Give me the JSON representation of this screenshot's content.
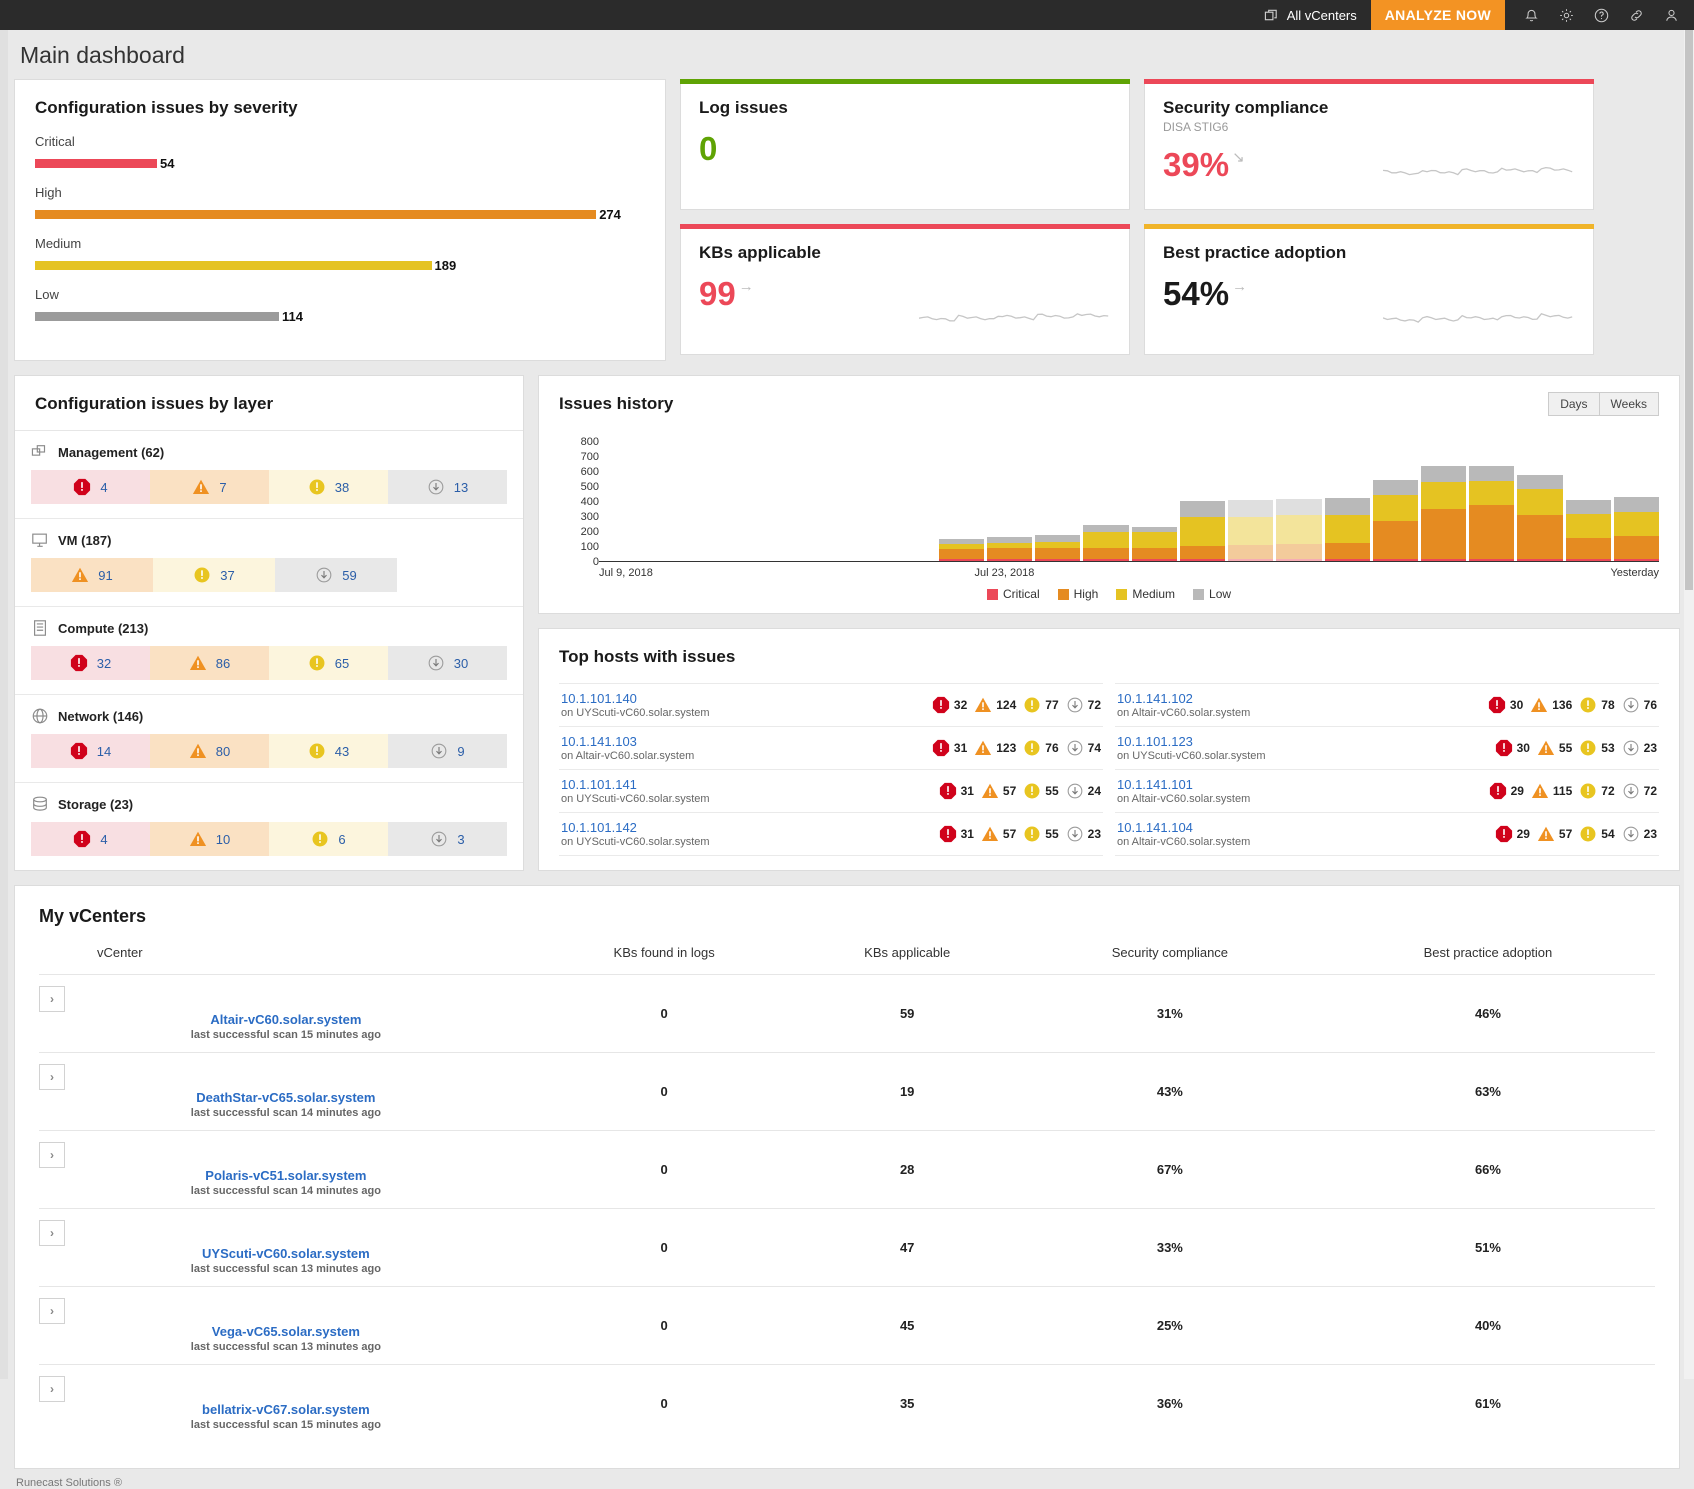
{
  "topbar": {
    "vcenters_label": "All vCenters",
    "analyze_label": "ANALYZE NOW",
    "icons": [
      "bell-icon",
      "gear-icon",
      "help-icon",
      "link-icon",
      "user-icon"
    ]
  },
  "page_title": "Main dashboard",
  "severity_card": {
    "title": "Configuration issues by severity",
    "items": [
      {
        "label": "Critical",
        "value": "54",
        "pct": 20,
        "color": "#ec4858"
      },
      {
        "label": "High",
        "value": "274",
        "pct": 92,
        "color": "#e58b21"
      },
      {
        "label": "Medium",
        "value": "189",
        "pct": 65,
        "color": "#e5c322"
      },
      {
        "label": "Low",
        "value": "114",
        "pct": 40,
        "color": "#9b9b9b"
      }
    ]
  },
  "kpis": [
    {
      "title": "Log issues",
      "subtitle": "",
      "value": "0",
      "accent": "#5fa304",
      "value_color": "#5fa304",
      "trend": "",
      "sparkline": false
    },
    {
      "title": "KBs applicable",
      "subtitle": "",
      "value": "99",
      "accent": "#ec4858",
      "value_color": "#ec4858",
      "trend": "→",
      "sparkline": true
    },
    {
      "title": "Security compliance",
      "subtitle": "DISA STIG6",
      "value": "39%",
      "accent": "#ec4858",
      "value_color": "#ec4858",
      "trend": "↘",
      "sparkline": true
    },
    {
      "title": "Best practice adoption",
      "subtitle": "",
      "value": "54%",
      "accent": "#f0b429",
      "value_color": "#1a1a1a",
      "trend": "→",
      "sparkline": true
    }
  ],
  "layer_card": {
    "title": "Configuration issues by layer",
    "layers": [
      {
        "icon": "management-icon",
        "label": "Management (62)",
        "chips": [
          {
            "sev": "critical",
            "value": "4"
          },
          {
            "sev": "high",
            "value": "7"
          },
          {
            "sev": "medium",
            "value": "38"
          },
          {
            "sev": "low",
            "value": "13"
          }
        ]
      },
      {
        "icon": "vm-icon",
        "label": "VM (187)",
        "chips": [
          {
            "sev": "high",
            "value": "91"
          },
          {
            "sev": "medium",
            "value": "37"
          },
          {
            "sev": "low",
            "value": "59"
          }
        ]
      },
      {
        "icon": "compute-icon",
        "label": "Compute (213)",
        "chips": [
          {
            "sev": "critical",
            "value": "32"
          },
          {
            "sev": "high",
            "value": "86"
          },
          {
            "sev": "medium",
            "value": "65"
          },
          {
            "sev": "low",
            "value": "30"
          }
        ]
      },
      {
        "icon": "network-icon",
        "label": "Network (146)",
        "chips": [
          {
            "sev": "critical",
            "value": "14"
          },
          {
            "sev": "high",
            "value": "80"
          },
          {
            "sev": "medium",
            "value": "43"
          },
          {
            "sev": "low",
            "value": "9"
          }
        ]
      },
      {
        "icon": "storage-icon",
        "label": "Storage (23)",
        "chips": [
          {
            "sev": "critical",
            "value": "4"
          },
          {
            "sev": "high",
            "value": "10"
          },
          {
            "sev": "medium",
            "value": "6"
          },
          {
            "sev": "low",
            "value": "3"
          }
        ]
      }
    ]
  },
  "history_card": {
    "title": "Issues history",
    "toggle": {
      "days": "Days",
      "weeks": "Weeks",
      "selected": "Days"
    }
  },
  "chart_data": {
    "type": "bar",
    "title": "Issues history",
    "stacked": true,
    "xlabel": "",
    "ylabel": "",
    "ylim": [
      0,
      800
    ],
    "yticks": [
      800,
      700,
      600,
      500,
      400,
      300,
      200,
      100,
      0
    ],
    "grid": false,
    "legend_position": "bottom",
    "x_tick_labels": [
      "Jul 9, 2018",
      "Jul 23, 2018",
      "Yesterday"
    ],
    "categories": [
      "d1",
      "d2",
      "d3",
      "d4",
      "d5",
      "d6",
      "d7",
      "d8",
      "d9",
      "d10",
      "d11",
      "d12",
      "d13",
      "d14",
      "d15",
      "d16",
      "d17",
      "d18",
      "d19",
      "d20",
      "d21",
      "d22"
    ],
    "series": [
      {
        "name": "Critical",
        "color": "#ec4858",
        "values": [
          0,
          0,
          0,
          0,
          0,
          0,
          0,
          12,
          12,
          12,
          14,
          14,
          14,
          14,
          16,
          16,
          16,
          16,
          16,
          16,
          16,
          16
        ]
      },
      {
        "name": "High",
        "color": "#e58b21",
        "values": [
          0,
          0,
          0,
          0,
          0,
          0,
          0,
          70,
          72,
          78,
          72,
          70,
          88,
          90,
          100,
          104,
          250,
          330,
          355,
          290,
          140,
          150
        ]
      },
      {
        "name": "Medium",
        "color": "#e5c322",
        "values": [
          0,
          0,
          0,
          0,
          0,
          0,
          0,
          30,
          34,
          40,
          110,
          110,
          190,
          190,
          190,
          190,
          175,
          180,
          165,
          175,
          155,
          160
        ]
      },
      {
        "name": "Low",
        "color": "#b9b9b9",
        "values": [
          0,
          0,
          0,
          0,
          0,
          0,
          0,
          35,
          40,
          45,
          45,
          35,
          105,
          110,
          110,
          110,
          100,
          105,
          100,
          90,
          95,
          100
        ]
      }
    ]
  },
  "hosts_card": {
    "title": "Top hosts with issues",
    "columns": [
      [
        {
          "ip": "10.1.101.140",
          "on": "on UYScuti-vC60.solar.system",
          "critical": "32",
          "high": "124",
          "medium": "77",
          "low": "72"
        },
        {
          "ip": "10.1.141.103",
          "on": "on Altair-vC60.solar.system",
          "critical": "31",
          "high": "123",
          "medium": "76",
          "low": "74"
        },
        {
          "ip": "10.1.101.141",
          "on": "on UYScuti-vC60.solar.system",
          "critical": "31",
          "high": "57",
          "medium": "55",
          "low": "24"
        },
        {
          "ip": "10.1.101.142",
          "on": "on UYScuti-vC60.solar.system",
          "critical": "31",
          "high": "57",
          "medium": "55",
          "low": "23"
        }
      ],
      [
        {
          "ip": "10.1.141.102",
          "on": "on Altair-vC60.solar.system",
          "critical": "30",
          "high": "136",
          "medium": "78",
          "low": "76"
        },
        {
          "ip": "10.1.101.123",
          "on": "on UYScuti-vC60.solar.system",
          "critical": "30",
          "high": "55",
          "medium": "53",
          "low": "23"
        },
        {
          "ip": "10.1.141.101",
          "on": "on Altair-vC60.solar.system",
          "critical": "29",
          "high": "115",
          "medium": "72",
          "low": "72"
        },
        {
          "ip": "10.1.141.104",
          "on": "on Altair-vC60.solar.system",
          "critical": "29",
          "high": "57",
          "medium": "54",
          "low": "23"
        }
      ]
    ]
  },
  "vcenters_card": {
    "title": "My vCenters",
    "headers": [
      "vCenter",
      "KBs found in logs",
      "KBs applicable",
      "Security compliance",
      "Best practice adoption"
    ],
    "rows": [
      {
        "name": "Altair-vC60.solar.system",
        "scan": "last successful scan 15 minutes ago",
        "kbs_logs": "0",
        "kbs_applicable": "59",
        "security": "31%",
        "best_practice": "46%"
      },
      {
        "name": "DeathStar-vC65.solar.system",
        "scan": "last successful scan 14 minutes ago",
        "kbs_logs": "0",
        "kbs_applicable": "19",
        "security": "43%",
        "best_practice": "63%"
      },
      {
        "name": "Polaris-vC51.solar.system",
        "scan": "last successful scan 14 minutes ago",
        "kbs_logs": "0",
        "kbs_applicable": "28",
        "security": "67%",
        "best_practice": "66%"
      },
      {
        "name": "UYScuti-vC60.solar.system",
        "scan": "last successful scan 13 minutes ago",
        "kbs_logs": "0",
        "kbs_applicable": "47",
        "security": "33%",
        "best_practice": "51%"
      },
      {
        "name": "Vega-vC65.solar.system",
        "scan": "last successful scan 13 minutes ago",
        "kbs_logs": "0",
        "kbs_applicable": "45",
        "security": "25%",
        "best_practice": "40%"
      },
      {
        "name": "bellatrix-vC67.solar.system",
        "scan": "last successful scan 15 minutes ago",
        "kbs_logs": "0",
        "kbs_applicable": "35",
        "security": "36%",
        "best_practice": "61%"
      }
    ]
  },
  "footer": "Runecast Solutions ®"
}
